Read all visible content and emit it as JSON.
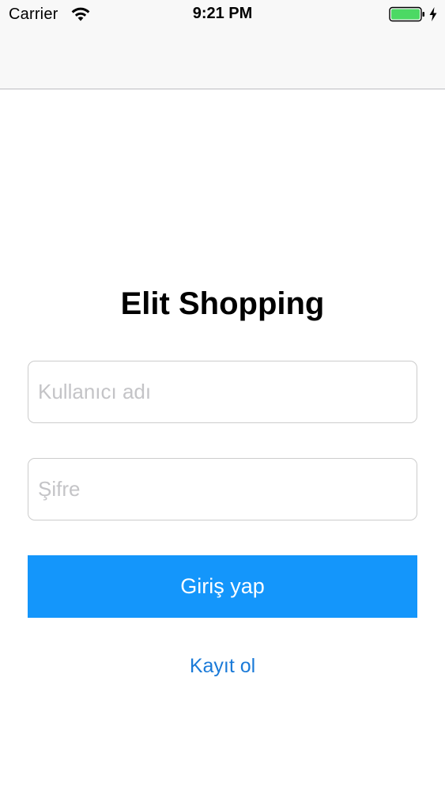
{
  "status_bar": {
    "carrier": "Carrier",
    "time": "9:21 PM",
    "battery_level": 1.0,
    "icons": [
      "wifi-icon",
      "battery-icon",
      "charging-bolt-icon"
    ]
  },
  "login": {
    "title": "Elit Shopping",
    "username_placeholder": "Kullanıcı adı",
    "password_placeholder": "Şifre",
    "login_button_label": "Giriş yap",
    "register_link_label": "Kayıt ol"
  },
  "colors": {
    "primary_button": "#1496fb",
    "link": "#1a7ad8",
    "battery_fill": "#4cd964"
  }
}
